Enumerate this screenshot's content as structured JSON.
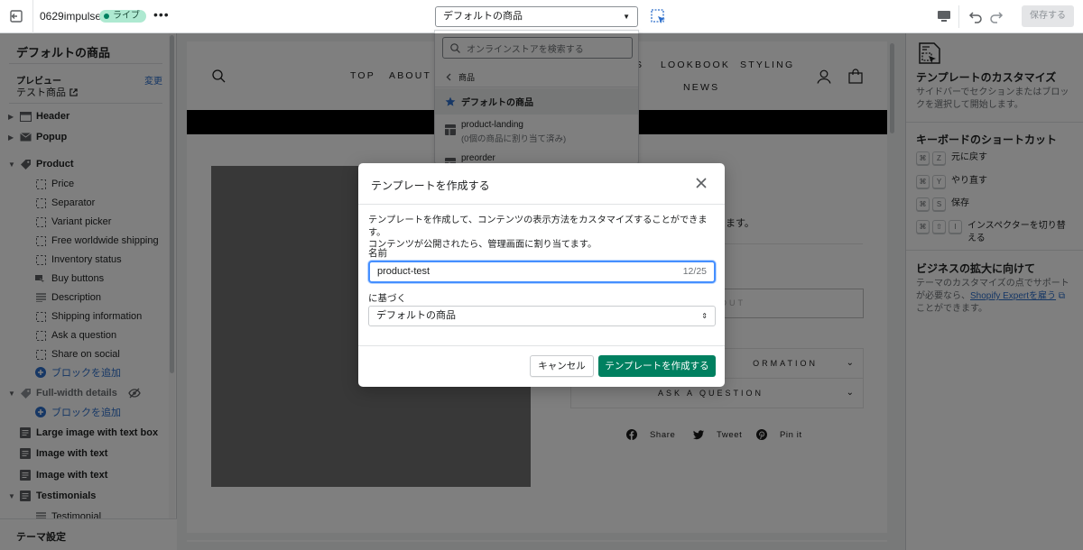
{
  "topbar": {
    "store_name": "0629impulse",
    "status_badge": "ライブ",
    "more": "•••",
    "template_select": "デフォルトの商品",
    "save_label": "保存する"
  },
  "left_sidebar": {
    "title": "デフォルトの商品",
    "preview_label": "プレビュー",
    "preview_change": "変更",
    "preview_value": "テスト商品",
    "items": [
      {
        "label": "Header"
      },
      {
        "label": "Popup"
      },
      {
        "label": "Product"
      },
      {
        "label": "Price"
      },
      {
        "label": "Separator"
      },
      {
        "label": "Variant picker"
      },
      {
        "label": "Free worldwide shipping"
      },
      {
        "label": "Inventory status"
      },
      {
        "label": "Buy buttons"
      },
      {
        "label": "Description"
      },
      {
        "label": "Shipping information"
      },
      {
        "label": "Ask a question"
      },
      {
        "label": "Share on social"
      },
      {
        "label": "ブロックを追加"
      },
      {
        "label": "Full-width details"
      },
      {
        "label": "ブロックを追加"
      },
      {
        "label": "Large image with text box"
      },
      {
        "label": "Image with text"
      },
      {
        "label": "Image with text"
      },
      {
        "label": "Testimonials"
      },
      {
        "label": "Testimonial"
      }
    ],
    "footer": "テーマ設定"
  },
  "store_preview": {
    "nav": [
      "TOP",
      "ABOUT",
      "S",
      "LOOKBOOK",
      "STYLING",
      "NEWS"
    ],
    "product_text": "ます。",
    "sold_button": "OUT",
    "accordions": [
      "ORMATION",
      "ASK A QUESTION"
    ],
    "share": [
      "Share",
      "Tweet",
      "Pin it"
    ]
  },
  "template_dropdown": {
    "search_placeholder": "オンラインストアを検索する",
    "back_label": "商品",
    "items": [
      {
        "label": "デフォルトの商品",
        "sub": ""
      },
      {
        "label": "product-landing",
        "sub": "(0個の商品に割り当て済み)"
      },
      {
        "label": "preorder",
        "sub": ""
      }
    ]
  },
  "modal": {
    "title": "テンプレートを作成する",
    "description_1": "テンプレートを作成して、コンテンツの表示方法をカスタマイズすることができます。",
    "description_2": "コンテンツが公開されたら、管理画面に割り当てます。",
    "name_label": "名前",
    "name_value": "product-test",
    "name_count": "12/25",
    "based_on_label": "に基づく",
    "based_on_value": "デフォルトの商品",
    "cancel_label": "キャンセル",
    "create_label": "テンプレートを作成する"
  },
  "right_sidebar": {
    "customize_title": "テンプレートのカスタマイズ",
    "customize_desc": "サイドバーでセクションまたはブロックを選択して開始します。",
    "shortcuts_title": "キーボードのショートカット",
    "shortcuts": [
      {
        "keys": [
          "⌘",
          "Z"
        ],
        "label": "元に戻す"
      },
      {
        "keys": [
          "⌘",
          "Y"
        ],
        "label": "やり直す"
      },
      {
        "keys": [
          "⌘",
          "S"
        ],
        "label": "保存"
      },
      {
        "keys": [
          "⌘",
          "⇧",
          "I"
        ],
        "label": "インスペクターを切り替える"
      }
    ],
    "expand_title": "ビジネスの拡大に向けて",
    "expand_desc_1": "テーマのカスタマイズの点でサポートが必要なら、",
    "expand_link": "Shopify Expertを雇う",
    "expand_desc_2": "ことができます。"
  },
  "colors": {
    "primary": "#008060",
    "link": "#2c6ecb",
    "focus": "#458fff",
    "badge_bg": "#aee9d1"
  }
}
